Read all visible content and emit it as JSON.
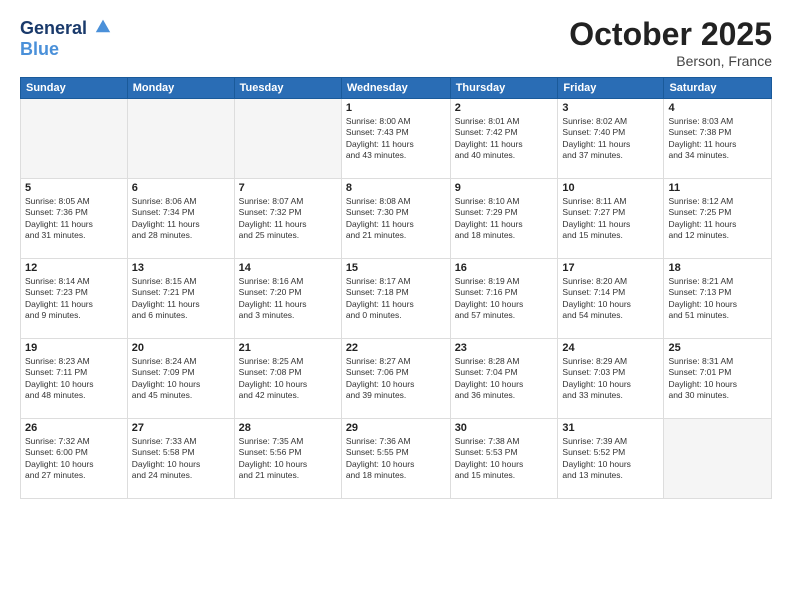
{
  "header": {
    "logo_line1": "General",
    "logo_line2": "Blue",
    "month_title": "October 2025",
    "location": "Berson, France"
  },
  "weekdays": [
    "Sunday",
    "Monday",
    "Tuesday",
    "Wednesday",
    "Thursday",
    "Friday",
    "Saturday"
  ],
  "weeks": [
    [
      {
        "day": "",
        "info": ""
      },
      {
        "day": "",
        "info": ""
      },
      {
        "day": "",
        "info": ""
      },
      {
        "day": "1",
        "info": "Sunrise: 8:00 AM\nSunset: 7:43 PM\nDaylight: 11 hours\nand 43 minutes."
      },
      {
        "day": "2",
        "info": "Sunrise: 8:01 AM\nSunset: 7:42 PM\nDaylight: 11 hours\nand 40 minutes."
      },
      {
        "day": "3",
        "info": "Sunrise: 8:02 AM\nSunset: 7:40 PM\nDaylight: 11 hours\nand 37 minutes."
      },
      {
        "day": "4",
        "info": "Sunrise: 8:03 AM\nSunset: 7:38 PM\nDaylight: 11 hours\nand 34 minutes."
      }
    ],
    [
      {
        "day": "5",
        "info": "Sunrise: 8:05 AM\nSunset: 7:36 PM\nDaylight: 11 hours\nand 31 minutes."
      },
      {
        "day": "6",
        "info": "Sunrise: 8:06 AM\nSunset: 7:34 PM\nDaylight: 11 hours\nand 28 minutes."
      },
      {
        "day": "7",
        "info": "Sunrise: 8:07 AM\nSunset: 7:32 PM\nDaylight: 11 hours\nand 25 minutes."
      },
      {
        "day": "8",
        "info": "Sunrise: 8:08 AM\nSunset: 7:30 PM\nDaylight: 11 hours\nand 21 minutes."
      },
      {
        "day": "9",
        "info": "Sunrise: 8:10 AM\nSunset: 7:29 PM\nDaylight: 11 hours\nand 18 minutes."
      },
      {
        "day": "10",
        "info": "Sunrise: 8:11 AM\nSunset: 7:27 PM\nDaylight: 11 hours\nand 15 minutes."
      },
      {
        "day": "11",
        "info": "Sunrise: 8:12 AM\nSunset: 7:25 PM\nDaylight: 11 hours\nand 12 minutes."
      }
    ],
    [
      {
        "day": "12",
        "info": "Sunrise: 8:14 AM\nSunset: 7:23 PM\nDaylight: 11 hours\nand 9 minutes."
      },
      {
        "day": "13",
        "info": "Sunrise: 8:15 AM\nSunset: 7:21 PM\nDaylight: 11 hours\nand 6 minutes."
      },
      {
        "day": "14",
        "info": "Sunrise: 8:16 AM\nSunset: 7:20 PM\nDaylight: 11 hours\nand 3 minutes."
      },
      {
        "day": "15",
        "info": "Sunrise: 8:17 AM\nSunset: 7:18 PM\nDaylight: 11 hours\nand 0 minutes."
      },
      {
        "day": "16",
        "info": "Sunrise: 8:19 AM\nSunset: 7:16 PM\nDaylight: 10 hours\nand 57 minutes."
      },
      {
        "day": "17",
        "info": "Sunrise: 8:20 AM\nSunset: 7:14 PM\nDaylight: 10 hours\nand 54 minutes."
      },
      {
        "day": "18",
        "info": "Sunrise: 8:21 AM\nSunset: 7:13 PM\nDaylight: 10 hours\nand 51 minutes."
      }
    ],
    [
      {
        "day": "19",
        "info": "Sunrise: 8:23 AM\nSunset: 7:11 PM\nDaylight: 10 hours\nand 48 minutes."
      },
      {
        "day": "20",
        "info": "Sunrise: 8:24 AM\nSunset: 7:09 PM\nDaylight: 10 hours\nand 45 minutes."
      },
      {
        "day": "21",
        "info": "Sunrise: 8:25 AM\nSunset: 7:08 PM\nDaylight: 10 hours\nand 42 minutes."
      },
      {
        "day": "22",
        "info": "Sunrise: 8:27 AM\nSunset: 7:06 PM\nDaylight: 10 hours\nand 39 minutes."
      },
      {
        "day": "23",
        "info": "Sunrise: 8:28 AM\nSunset: 7:04 PM\nDaylight: 10 hours\nand 36 minutes."
      },
      {
        "day": "24",
        "info": "Sunrise: 8:29 AM\nSunset: 7:03 PM\nDaylight: 10 hours\nand 33 minutes."
      },
      {
        "day": "25",
        "info": "Sunrise: 8:31 AM\nSunset: 7:01 PM\nDaylight: 10 hours\nand 30 minutes."
      }
    ],
    [
      {
        "day": "26",
        "info": "Sunrise: 7:32 AM\nSunset: 6:00 PM\nDaylight: 10 hours\nand 27 minutes."
      },
      {
        "day": "27",
        "info": "Sunrise: 7:33 AM\nSunset: 5:58 PM\nDaylight: 10 hours\nand 24 minutes."
      },
      {
        "day": "28",
        "info": "Sunrise: 7:35 AM\nSunset: 5:56 PM\nDaylight: 10 hours\nand 21 minutes."
      },
      {
        "day": "29",
        "info": "Sunrise: 7:36 AM\nSunset: 5:55 PM\nDaylight: 10 hours\nand 18 minutes."
      },
      {
        "day": "30",
        "info": "Sunrise: 7:38 AM\nSunset: 5:53 PM\nDaylight: 10 hours\nand 15 minutes."
      },
      {
        "day": "31",
        "info": "Sunrise: 7:39 AM\nSunset: 5:52 PM\nDaylight: 10 hours\nand 13 minutes."
      },
      {
        "day": "",
        "info": ""
      }
    ]
  ]
}
